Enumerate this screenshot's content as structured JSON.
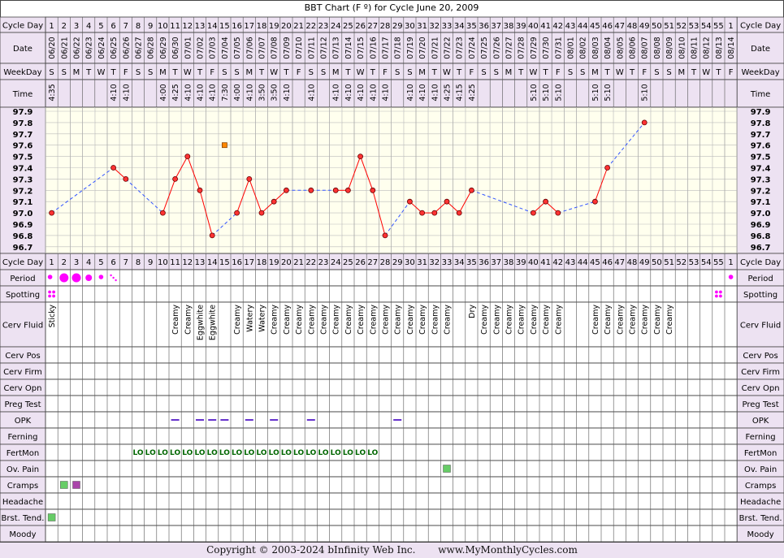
{
  "title": "BBT Chart (F º) for Cycle June 20, 2009",
  "row_labels": {
    "cycle_day": "Cycle Day",
    "date": "Date",
    "weekday": "WeekDay",
    "time": "Time",
    "period": "Period",
    "spotting": "Spotting",
    "cerv_fluid": "Cerv Fluid",
    "cerv_pos": "Cerv Pos",
    "cerv_firm": "Cerv Firm",
    "cerv_opn": "Cerv Opn",
    "preg_test": "Preg Test",
    "opk": "OPK",
    "ferning": "Ferning",
    "fertmon": "FertMon",
    "ov_pain": "Ov. Pain",
    "cramps": "Cramps",
    "headache": "Headache",
    "brst_tend": "Brst. Tend.",
    "moody": "Moody"
  },
  "cycle_days": [
    "1",
    "2",
    "3",
    "4",
    "5",
    "6",
    "7",
    "8",
    "9",
    "10",
    "11",
    "12",
    "13",
    "14",
    "15",
    "16",
    "17",
    "18",
    "19",
    "20",
    "21",
    "22",
    "23",
    "24",
    "25",
    "26",
    "27",
    "28",
    "29",
    "30",
    "31",
    "32",
    "33",
    "34",
    "35",
    "36",
    "37",
    "38",
    "39",
    "40",
    "41",
    "42",
    "43",
    "44",
    "45",
    "46",
    "47",
    "48",
    "49",
    "50",
    "51",
    "52",
    "53",
    "54",
    "55",
    "1"
  ],
  "dates": [
    "06/20",
    "06/21",
    "06/22",
    "06/23",
    "06/24",
    "06/25",
    "06/26",
    "06/27",
    "06/28",
    "06/29",
    "06/30",
    "07/01",
    "07/02",
    "07/03",
    "07/04",
    "07/05",
    "07/06",
    "07/07",
    "07/08",
    "07/09",
    "07/10",
    "07/11",
    "07/12",
    "07/13",
    "07/14",
    "07/15",
    "07/16",
    "07/17",
    "07/18",
    "07/19",
    "07/20",
    "07/21",
    "07/22",
    "07/23",
    "07/24",
    "07/25",
    "07/26",
    "07/27",
    "07/28",
    "07/29",
    "07/30",
    "07/31",
    "08/01",
    "08/02",
    "08/03",
    "08/04",
    "08/05",
    "08/06",
    "08/07",
    "08/08",
    "08/09",
    "08/10",
    "08/11",
    "08/12",
    "08/13",
    "08/14"
  ],
  "weekdays": [
    "S",
    "S",
    "M",
    "T",
    "W",
    "T",
    "F",
    "S",
    "S",
    "M",
    "T",
    "W",
    "T",
    "F",
    "S",
    "S",
    "M",
    "T",
    "W",
    "T",
    "F",
    "S",
    "S",
    "M",
    "T",
    "W",
    "T",
    "F",
    "S",
    "S",
    "M",
    "T",
    "W",
    "T",
    "F",
    "S",
    "S",
    "M",
    "T",
    "W",
    "T",
    "F",
    "S",
    "S",
    "M",
    "T",
    "W",
    "T",
    "F",
    "S",
    "S",
    "M",
    "T",
    "W",
    "T",
    "F"
  ],
  "times": [
    "4:35",
    "",
    "",
    "",
    "",
    "4:10",
    "4:10",
    "",
    "",
    "4:00",
    "4:25",
    "4:10",
    "4:10",
    "4:10",
    "7:30",
    "4:00",
    "4:10",
    "3:50",
    "3:50",
    "4:10",
    "",
    "4:10",
    "",
    "4:10",
    "4:10",
    "4:10",
    "4:10",
    "4:10",
    "",
    "4:10",
    "4:10",
    "4:10",
    "4:25",
    "4:15",
    "4:25",
    "",
    "",
    "",
    "",
    "5:10",
    "5:10",
    "5:10",
    "",
    "",
    "5:10",
    "5:10",
    "",
    "",
    "5:10",
    "",
    "",
    "",
    "",
    "",
    "",
    ""
  ],
  "temp_axis": [
    "97.9",
    "97.8",
    "97.7",
    "97.6",
    "97.5",
    "97.4",
    "97.3",
    "97.2",
    "97.1",
    "97.0",
    "96.9",
    "96.8",
    "96.7"
  ],
  "period": [
    "spot",
    "heavy",
    "heavy",
    "medium",
    "spot",
    "light",
    "",
    "",
    "",
    "",
    "",
    "",
    "",
    "",
    "",
    "",
    "",
    "",
    "",
    "",
    "",
    "",
    "",
    "",
    "",
    "",
    "",
    "",
    "",
    "",
    "",
    "",
    "",
    "",
    "",
    "",
    "",
    "",
    "",
    "",
    "",
    "",
    "",
    "",
    "",
    "",
    "",
    "",
    "",
    "",
    "",
    "",
    "",
    "",
    "",
    "spot"
  ],
  "spotting": [
    1,
    0,
    0,
    0,
    0,
    0,
    0,
    0,
    0,
    0,
    0,
    0,
    0,
    0,
    0,
    0,
    0,
    0,
    0,
    0,
    0,
    0,
    0,
    0,
    0,
    0,
    0,
    0,
    0,
    0,
    0,
    0,
    0,
    0,
    0,
    0,
    0,
    0,
    0,
    0,
    0,
    0,
    0,
    0,
    0,
    0,
    0,
    0,
    0,
    0,
    0,
    0,
    0,
    0,
    1,
    0
  ],
  "cerv_fluid": [
    "Sticky",
    "",
    "",
    "",
    "",
    "",
    "",
    "",
    "",
    "",
    "Creamy",
    "Creamy",
    "Eggwhite",
    "Eggwhite",
    "",
    "Creamy",
    "Watery",
    "Watery",
    "Creamy",
    "Creamy",
    "Creamy",
    "Creamy",
    "Creamy",
    "Creamy",
    "Creamy",
    "Creamy",
    "Creamy",
    "Creamy",
    "Creamy",
    "Creamy",
    "Creamy",
    "Creamy",
    "Creamy",
    "",
    "Dry",
    "Creamy",
    "Creamy",
    "Creamy",
    "Creamy",
    "Creamy",
    "Creamy",
    "Creamy",
    "",
    "",
    "Creamy",
    "Creamy",
    "Creamy",
    "Creamy",
    "Creamy",
    "Creamy",
    "Creamy",
    "",
    "",
    "",
    "",
    ""
  ],
  "opk_days": [
    11,
    13,
    14,
    15,
    17,
    19,
    22,
    29
  ],
  "fertmon": [
    "",
    "",
    "",
    "",
    "",
    "",
    "",
    "LO",
    "LO",
    "LO",
    "LO",
    "LO",
    "LO",
    "LO",
    "LO",
    "LO",
    "LO",
    "LO",
    "LO",
    "LO",
    "LO",
    "LO",
    "LO",
    "LO",
    "LO",
    "LO",
    "LO",
    "",
    "",
    "",
    "",
    "",
    "",
    "",
    "",
    "",
    "",
    "",
    "",
    "",
    "",
    "",
    "",
    "",
    "",
    "",
    "",
    "",
    "",
    "",
    "",
    "",
    "",
    "",
    "",
    ""
  ],
  "ov_pain_days": [
    33
  ],
  "cramps": [
    {
      "day": 2,
      "color": "#66cc66"
    },
    {
      "day": 3,
      "color": "#aa44aa"
    }
  ],
  "brst_tend_days": [
    1
  ],
  "footer": {
    "copyright": "Copyright © 2003-2024 bInfinity Web Inc.",
    "site": "www.MyMonthlyCycles.com"
  },
  "colors": {
    "line": "#ff0000",
    "dashed": "#3355ff",
    "dot": "#ff3333",
    "period": "#ff00ff",
    "grid_bg": "#ffffee",
    "header_bg": "#ede2f2",
    "opk": "#6633cc",
    "fertmon": "#006600",
    "green_box": "#66cc66",
    "special_marker": "#ff8800"
  },
  "chart_data": {
    "type": "line",
    "title": "BBT Chart (F º) for Cycle June 20, 2009",
    "xlabel": "Cycle Day",
    "ylabel": "",
    "ylim": [
      96.7,
      97.9
    ],
    "x": [
      1,
      6,
      7,
      10,
      11,
      12,
      13,
      14,
      16,
      17,
      18,
      19,
      20,
      22,
      24,
      25,
      26,
      27,
      28,
      30,
      31,
      32,
      33,
      34,
      35,
      40,
      41,
      42,
      45,
      46,
      49
    ],
    "y": [
      97.0,
      97.4,
      97.3,
      97.0,
      97.3,
      97.5,
      97.2,
      96.8,
      97.0,
      97.3,
      97.0,
      97.1,
      97.2,
      97.2,
      97.2,
      97.2,
      97.5,
      97.2,
      96.8,
      97.1,
      97.0,
      97.0,
      97.1,
      97.0,
      97.2,
      97.0,
      97.1,
      97.0,
      97.1,
      97.4,
      97.8
    ],
    "special_points": [
      {
        "x": 15,
        "y": 97.6
      }
    ],
    "grid": true
  }
}
